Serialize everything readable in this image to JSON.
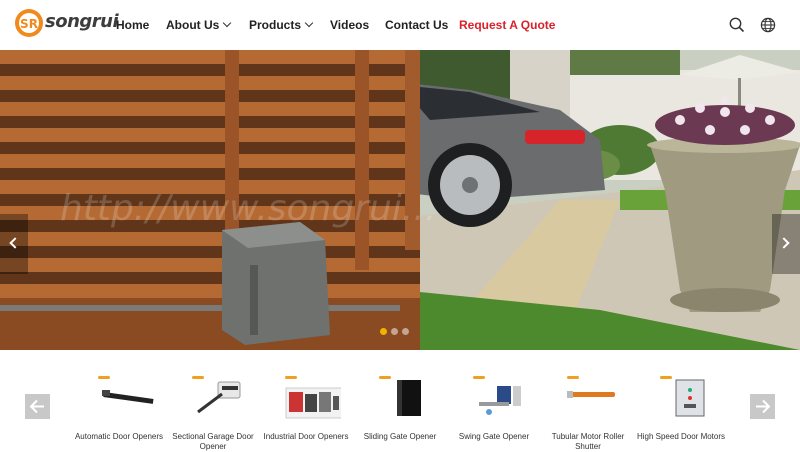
{
  "header": {
    "logo_text": "songrui",
    "logo_initials": "SR",
    "nav": [
      {
        "label": "Home"
      },
      {
        "label": "About Us"
      },
      {
        "label": "Products"
      },
      {
        "label": "Videos"
      },
      {
        "label": "Contact Us"
      },
      {
        "label": "Request A Quote"
      }
    ],
    "icons": [
      "search-icon",
      "globe-icon"
    ]
  },
  "banner": {
    "watermark": "http://www.songrui...",
    "slides_count": 3,
    "active_slide": 1
  },
  "products": [
    {
      "label": "Automatic Door Openers"
    },
    {
      "label": "Sectional Garage Door Opener"
    },
    {
      "label": "Industrial Door Openers"
    },
    {
      "label": "Sliding Gate Opener"
    },
    {
      "label": "Swing Gate Opener"
    },
    {
      "label": "Tubular Motor Roller Shutter"
    },
    {
      "label": "High Speed Door Motors"
    }
  ],
  "colors": {
    "accent_red": "#d8222a",
    "slider_dot_active": "#f0b400",
    "logo_orange": "#f08a1c"
  }
}
